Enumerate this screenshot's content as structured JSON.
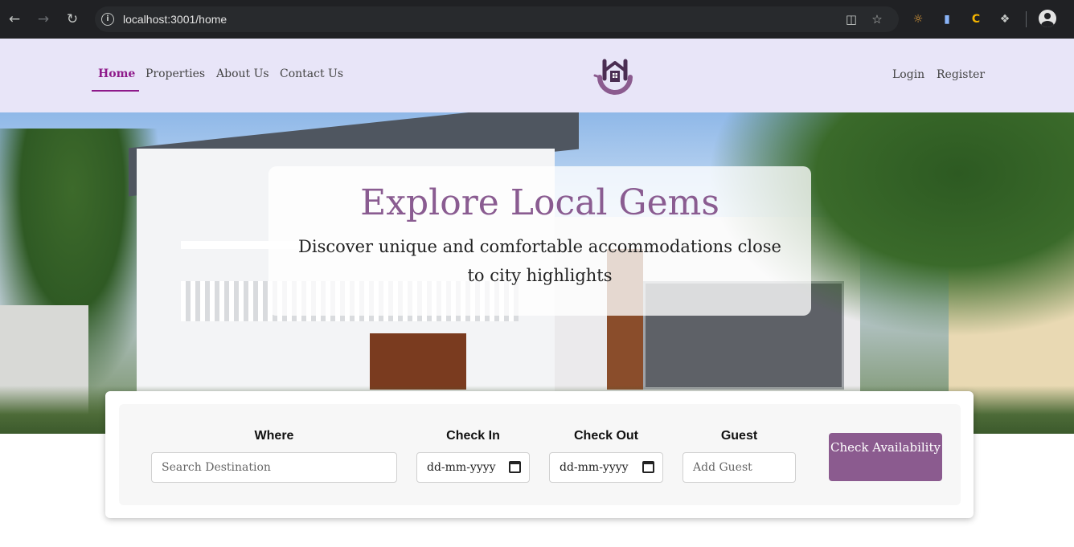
{
  "browser": {
    "url": "localhost:3001/home",
    "back_icon": "arrow-left-icon",
    "forward_icon": "arrow-right-icon",
    "reload_icon": "reload-icon"
  },
  "nav": {
    "items": [
      {
        "label": "Home",
        "active": true
      },
      {
        "label": "Properties",
        "active": false
      },
      {
        "label": "About Us",
        "active": false
      },
      {
        "label": "Contact Us",
        "active": false
      }
    ],
    "login": "Login",
    "register": "Register",
    "active_color": "#8e1a8a",
    "header_bg": "#e8e5f8"
  },
  "hero": {
    "title": "Explore Local Gems",
    "subtitle": "Discover unique and comfortable accommodations close to city highlights",
    "title_color": "#8a5c91"
  },
  "search": {
    "where_label": "Where",
    "where_placeholder": "Search Destination",
    "checkin_label": "Check In",
    "checkin_value": "dd-mm-yyyy",
    "checkout_label": "Check Out",
    "checkout_value": "dd-mm-yyyy",
    "guest_label": "Guest",
    "guest_placeholder": "Add Guest",
    "button_label": "Check Availability",
    "button_color": "#8b5b8f"
  }
}
